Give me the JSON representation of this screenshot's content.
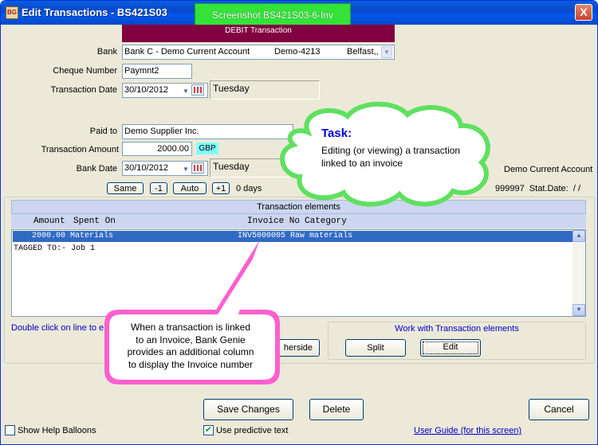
{
  "window": {
    "title": "Edit Transactions - BS421S03",
    "screenshot_badge": "Screenshot BS421S03-6-Inv",
    "close_label": "X",
    "app_icon_text": "BG"
  },
  "header": {
    "debit_label": "DEBIT Transaction"
  },
  "form": {
    "bank_label": "Bank",
    "bank_value": "Bank C - Demo Current Account",
    "bank_code": "Demo-4213",
    "bank_location": "Belfast,,",
    "cheque_label": "Cheque Number",
    "cheque_value": "Paymnt2",
    "txn_date_label": "Transaction Date",
    "txn_date_value": "30/10/2012",
    "txn_day": "Tuesday",
    "paid_to_label": "Paid to",
    "paid_to_value": "Demo Supplier Inc.",
    "amount_label": "Transaction Amount",
    "amount_value": "2000.00",
    "currency": "GBP",
    "bank_date_label": "Bank Date",
    "bank_date_value": "30/10/2012",
    "bank_day": "Tuesday",
    "right_account": "Demo Current Account",
    "right_stat": "999997  Stat.Date:  / /",
    "same_label": "Same",
    "minus1_label": "-1",
    "auto_label": "Auto",
    "plus1_label": "+1",
    "days_text": "0 days"
  },
  "elements": {
    "panel_title": "Transaction elements",
    "col_amount": "Amount",
    "col_spent_on": "Spent On",
    "col_invoice": "Invoice No",
    "col_category": "Category",
    "rows": [
      {
        "text": "    2000.00 Materials                          INV5000005 Raw materials"
      }
    ],
    "tagged_line": "TAGGED TO:- Job 1",
    "hint": "Double click on line to e",
    "otherside_label": "herside",
    "work_group_title": "Work with Transaction elements",
    "split_label": "Split",
    "edit_label": "Edit"
  },
  "task_cloud": {
    "title": "Task:",
    "text_line1": "Editing (or viewing) a transaction",
    "text_line2": "linked to an invoice"
  },
  "callout": {
    "line1": "When a transaction is linked",
    "line2": "to an Invoice, Bank Genie",
    "line3": "provides an additional column",
    "line4": "to display the Invoice number"
  },
  "footer": {
    "save_label": "Save Changes",
    "delete_label": "Delete",
    "cancel_label": "Cancel",
    "help_balloons_label": "Show Help Balloons",
    "predictive_label": "Use predictive text",
    "user_guide_label": "User Guide (for this screen)",
    "help_balloons_checked": false,
    "predictive_checked": true
  },
  "colors": {
    "title_blue": "#0a5ee0",
    "debit_bar": "#800040",
    "badge_green": "#34e23a",
    "selection_blue": "#316ac5",
    "cloud_green": "#5fe060",
    "callout_pink": "#ff5fcf"
  }
}
